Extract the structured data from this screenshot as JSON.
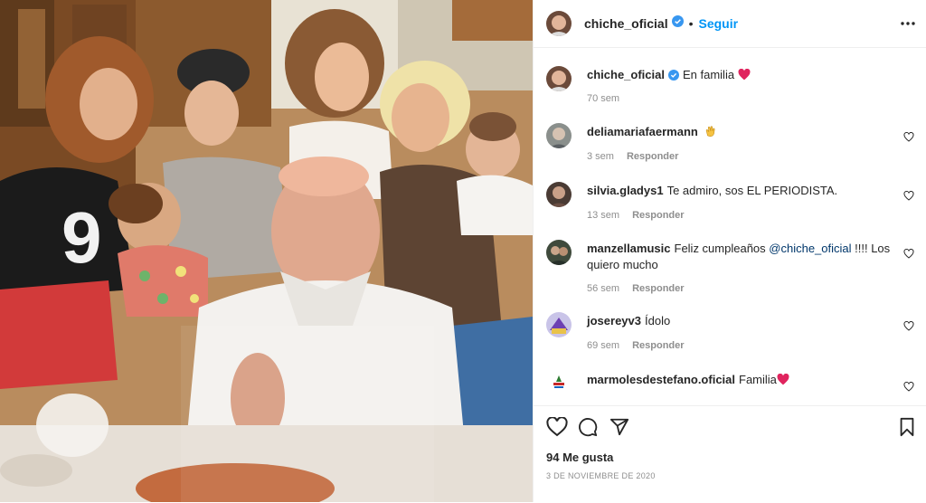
{
  "post": {
    "username": "chiche_oficial",
    "follow_label": "Seguir",
    "dot": "•",
    "caption_text": "En familia",
    "caption_age": "70 sem",
    "likes": "94 Me gusta",
    "date": "3 DE NOVIEMBRE DE 2020"
  },
  "comments": [
    {
      "user": "deliamariafaermann",
      "text": "",
      "age": "3 sem",
      "reply": "Responder"
    },
    {
      "user": "silvia.gladys1",
      "text": "Te admiro, sos EL PERIODISTA.",
      "age": "13 sem",
      "reply": "Responder"
    },
    {
      "user": "manzellamusic",
      "text_before": "Feliz cumpleaños ",
      "mention": "@chiche_oficial",
      "text_after": " !!!! Los quiero mucho",
      "age": "56 sem",
      "reply": "Responder"
    },
    {
      "user": "josereyv3",
      "text": "Ídolo",
      "age": "69 sem",
      "reply": "Responder"
    },
    {
      "user": "marmolesdestefano.oficial",
      "text": "Familia"
    }
  ],
  "icons": {
    "verified": "verified-badge-icon",
    "more": "more-options-icon",
    "heart": "heart-icon",
    "comment": "comment-icon",
    "share": "share-icon",
    "save": "bookmark-icon",
    "clap": "clapping-hands-emoji",
    "red_heart": "red-heart-emoji"
  },
  "colors": {
    "accent": "#0095f6",
    "verified": "#3897f0",
    "heart": "#ed4956",
    "muted": "#8e8e8e"
  }
}
